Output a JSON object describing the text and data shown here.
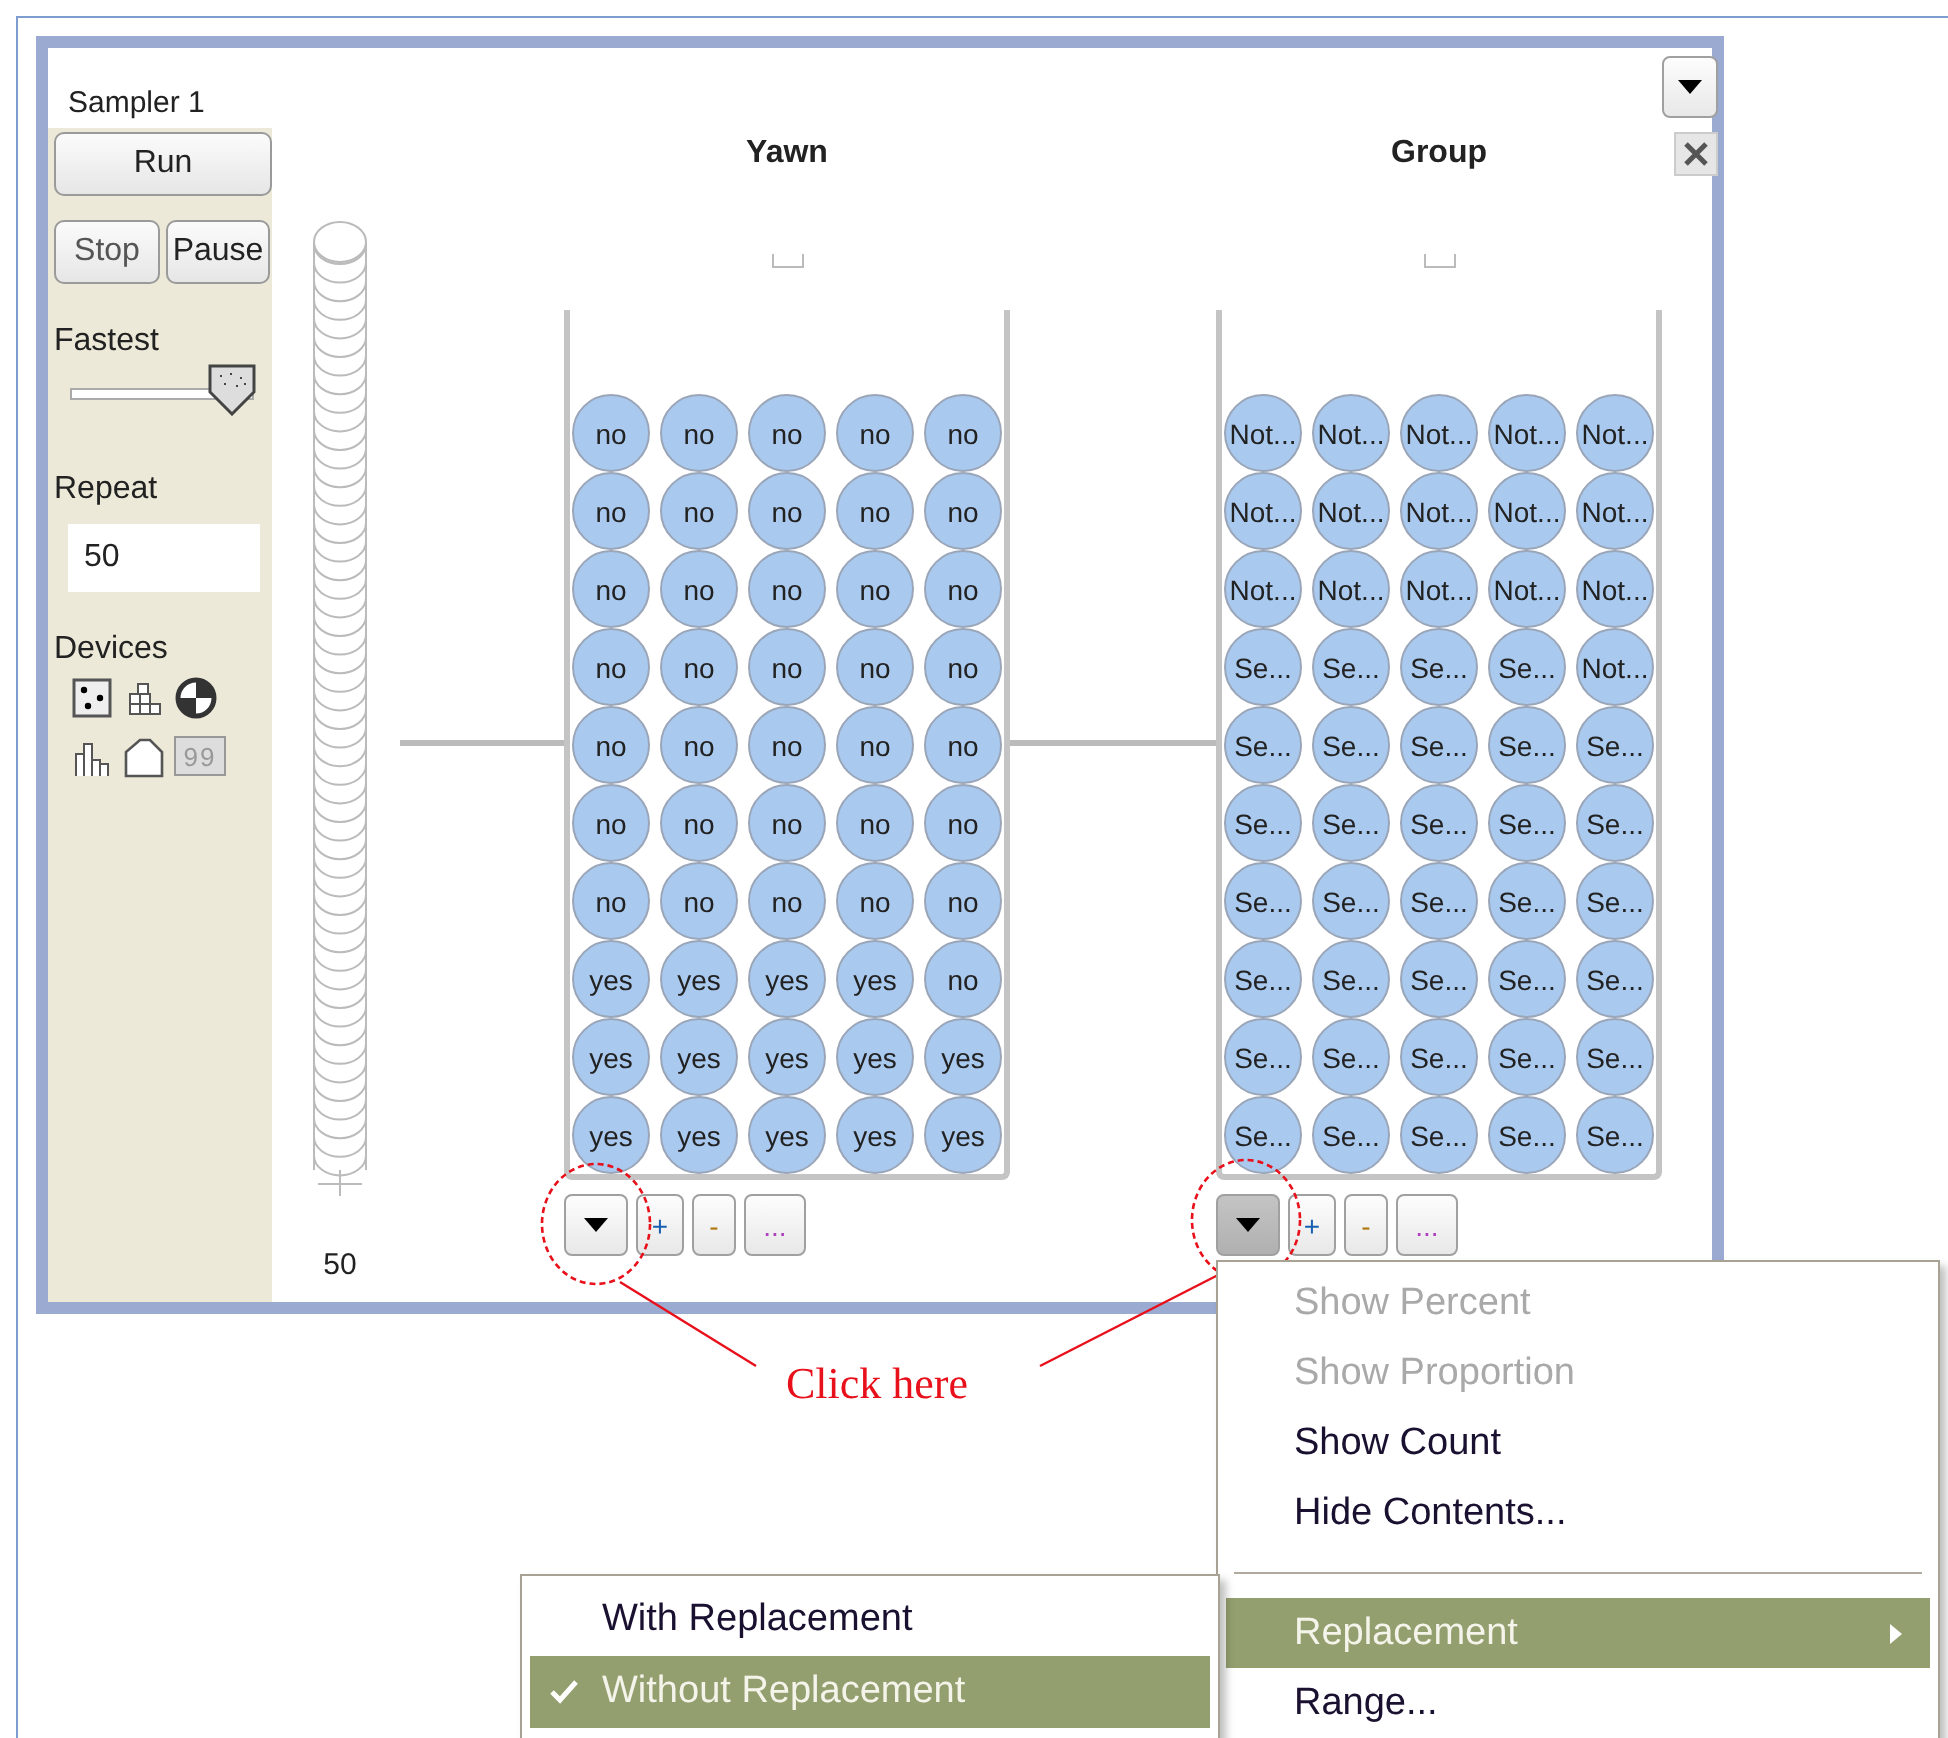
{
  "sampler": {
    "title": "Sampler 1",
    "run": "Run",
    "stop": "Stop",
    "pause": "Pause",
    "speed_label": "Fastest",
    "speed": {
      "level": 0.88
    },
    "repeat_label": "Repeat",
    "repeat_value": "50",
    "devices_label": "Devices",
    "device_icons": [
      {
        "kind": "dice"
      },
      {
        "kind": "stacks"
      },
      {
        "kind": "spinner"
      },
      {
        "kind": "bars"
      },
      {
        "kind": "curve"
      },
      {
        "kind": "counter",
        "label": "99"
      }
    ]
  },
  "stack": {
    "count": "50"
  },
  "devices": [
    {
      "title": "Yawn",
      "menu_open": false,
      "plus": "+",
      "minus": "-",
      "more": "...",
      "balls": [
        [
          "no",
          "no",
          "no",
          "no",
          "no"
        ],
        [
          "no",
          "no",
          "no",
          "no",
          "no"
        ],
        [
          "no",
          "no",
          "no",
          "no",
          "no"
        ],
        [
          "no",
          "no",
          "no",
          "no",
          "no"
        ],
        [
          "no",
          "no",
          "no",
          "no",
          "no"
        ],
        [
          "no",
          "no",
          "no",
          "no",
          "no"
        ],
        [
          "no",
          "no",
          "no",
          "no",
          "no"
        ],
        [
          "yes",
          "yes",
          "yes",
          "yes",
          "no"
        ],
        [
          "yes",
          "yes",
          "yes",
          "yes",
          "yes"
        ],
        [
          "yes",
          "yes",
          "yes",
          "yes",
          "yes"
        ]
      ]
    },
    {
      "title": "Group",
      "menu_open": true,
      "plus": "+",
      "minus": "-",
      "more": "...",
      "balls": [
        [
          "Not...",
          "Not...",
          "Not...",
          "Not...",
          "Not..."
        ],
        [
          "Not...",
          "Not...",
          "Not...",
          "Not...",
          "Not..."
        ],
        [
          "Not...",
          "Not...",
          "Not...",
          "Not...",
          "Not..."
        ],
        [
          "Se...",
          "Se...",
          "Se...",
          "Se...",
          "Not..."
        ],
        [
          "Se...",
          "Se...",
          "Se...",
          "Se...",
          "Se..."
        ],
        [
          "Se...",
          "Se...",
          "Se...",
          "Se...",
          "Se..."
        ],
        [
          "Se...",
          "Se...",
          "Se...",
          "Se...",
          "Se..."
        ],
        [
          "Se...",
          "Se...",
          "Se...",
          "Se...",
          "Se..."
        ],
        [
          "Se...",
          "Se...",
          "Se...",
          "Se...",
          "Se..."
        ],
        [
          "Se...",
          "Se...",
          "Se...",
          "Se...",
          "Se..."
        ]
      ]
    }
  ],
  "annotation": {
    "text": "Click here"
  },
  "menu": {
    "items": [
      {
        "kind": "item",
        "label": "Show Percent",
        "disabled": true,
        "selected": false
      },
      {
        "kind": "item",
        "label": "Show Proportion",
        "disabled": true,
        "selected": false
      },
      {
        "kind": "item",
        "label": "Show Count",
        "disabled": false,
        "selected": false
      },
      {
        "kind": "item",
        "label": "Hide Contents...",
        "disabled": false,
        "selected": false
      },
      {
        "kind": "separator"
      },
      {
        "kind": "submenu",
        "label": "Replacement",
        "disabled": false,
        "selected": true
      },
      {
        "kind": "item",
        "label": "Range...",
        "disabled": false,
        "selected": false
      }
    ]
  },
  "submenu": {
    "items": [
      {
        "label": "With Replacement",
        "checked": false,
        "selected": false
      },
      {
        "label": "Without Replacement",
        "checked": true,
        "selected": true
      }
    ]
  }
}
